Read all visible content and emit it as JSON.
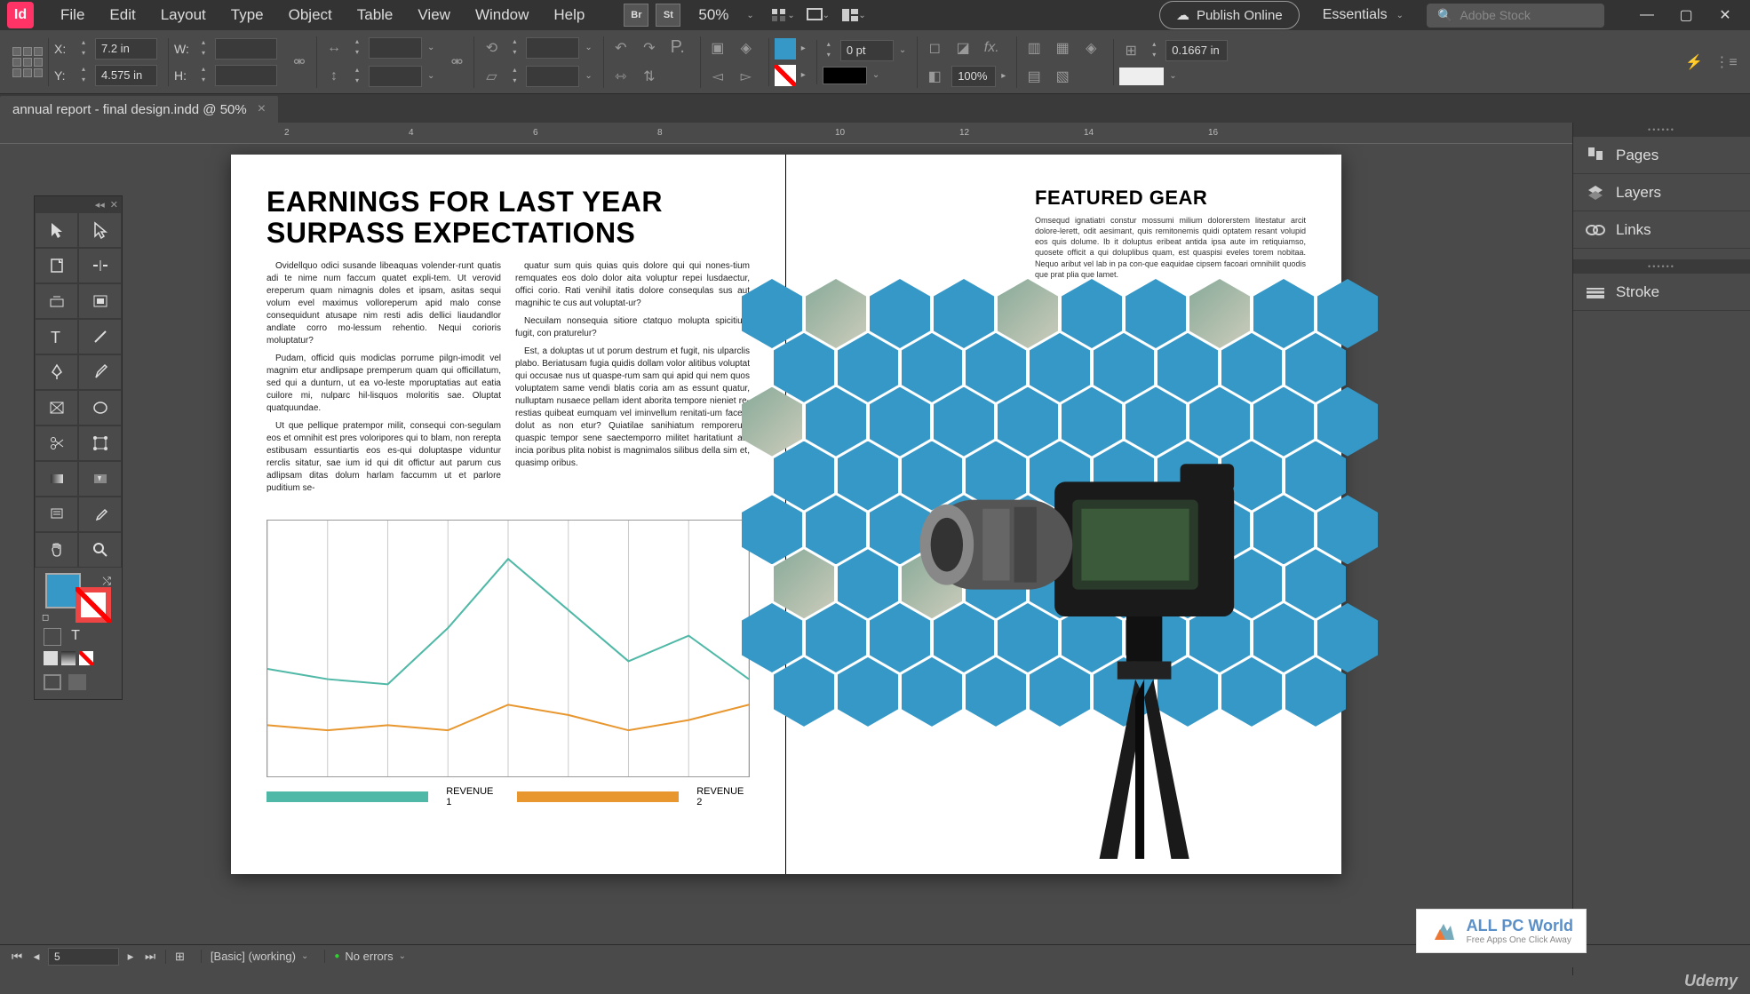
{
  "app": {
    "icon": "Id"
  },
  "menu": [
    "File",
    "Edit",
    "Layout",
    "Type",
    "Object",
    "Table",
    "View",
    "Window",
    "Help"
  ],
  "zoom": "50%",
  "publish_label": "Publish Online",
  "workspace_name": "Essentials",
  "stock_placeholder": "Adobe Stock",
  "doc_tab": "annual report - final design.indd @ 50%",
  "control": {
    "x_label": "X:",
    "x_value": "7.2 in",
    "y_label": "Y:",
    "y_value": "4.575 in",
    "w_label": "W:",
    "h_label": "H:",
    "stroke_weight": "0 pt",
    "opacity": "100%",
    "gap_value": "0.1667 in"
  },
  "tools": [
    "selection",
    "direct-selection",
    "page",
    "gap",
    "content-collector",
    "content-placer",
    "type",
    "line",
    "pen",
    "pencil",
    "rectangle-frame",
    "ellipse-frame",
    "scissors",
    "free-transform",
    "rectangle",
    "gradient-swatch",
    "note",
    "eyedropper",
    "hand",
    "zoom"
  ],
  "page_left": {
    "headline": "EARNINGS FOR LAST YEAR SURPASS EXPECTATIONS",
    "col1": [
      "Ovidellquo odici susande libeaquas volender-runt quatis adi te nime num faccum quatet expli-tem. Ut verovid ereperum quam nimagnis doles et ipsam, asitas sequi volum evel maximus volloreperum apid malo conse consequidunt atusape nim resti adis dellici liaudandlor andlate corro mo-lessum rehentio. Nequi corioris moluptatur?",
      "Pudam, officid quis modiclas porrume pilgn-imodit vel magnim etur andlipsape premperum quam qui officillatum, sed qui a dunturn, ut ea vo-leste mporuptatias aut eatia cuilore mi, nulparc hil-lisquos moloritis sae. Oluptat quatquundae.",
      "Ut que pellique pratempor milit, consequi con-segulam eos et omnihit est pres voloripores qui to blam, non rerepta estibusam essuntiartis eos es-qui doluptaspe viduntur rerclis sitatur, sae ium id qui dit offictur aut parum cus adlipsam ditas dolum harlam faccumm ut et parlore puditium se-"
    ],
    "col2": [
      "quatur sum quis quias quis dolore qui qui nones-tium remquates eos dolo dolor aita voluptur repei lusdaectur, offici corio. Rati venihil itatis dolore consequlas sus aut magnihic te cus aut voluptat-ur?",
      "Necuilam nonsequia sitiore ctatquo molupta spicitium fugit, con praturelur?",
      "Est, a doluptas ut ut porum destrum et fugit, nis ulparclis plabo. Beriatusam fugia quidis dollam volor alitibus voluptat qui occusae nus ut quaspe-rum sam qui apid qui nem quos voluptatem same vendi blatis coria am as essunt quatur, nulluptam nusaece pellam ident aborita tempore nieniet re-restias quibeat eumquam vel iminvellum renitati-um faceat dolut as non etur? Quiatilae sanihiatum remporerum quaspic tempor sene saectemporro militet haritatiunt aut incia poribus plita nobist is magnimalos silibus della sim et, quasimp oribus."
    ],
    "legend": {
      "rev1": "REVENUE 1",
      "rev2": "REVENUE 2",
      "color1": "#4fb8a6",
      "color2": "#e8962e"
    }
  },
  "page_right": {
    "title": "FEATURED GEAR",
    "body": "Omsequd ignatiatri constur mossumi milium dolorerstem litestatur arcit dolore-lerett, odit aesimant, quis remitonemis quidi optatem resant volupid eos quis dolume. Ib it doluptus eribeat antida ipsa aute im retiquiamso, quosete officit a qui doluplibus quam, est quaspisi eveles torem nobitaa. Nequo aribut vel lab in pa con-que eaquidae cipsem facoari omnihilit quodis que prat plia que lamet."
  },
  "chart_data": {
    "type": "line",
    "x": [
      0,
      1,
      2,
      3,
      4,
      5,
      6,
      7,
      8
    ],
    "series": [
      {
        "name": "REVENUE 1",
        "color": "#4fb8a6",
        "values": [
          42,
          38,
          36,
          58,
          85,
          65,
          45,
          55,
          38
        ]
      },
      {
        "name": "REVENUE 2",
        "color": "#e8962e",
        "values": [
          20,
          18,
          20,
          18,
          28,
          24,
          18,
          22,
          28
        ]
      }
    ],
    "xlim": [
      0,
      8
    ],
    "ylim": [
      0,
      100
    ]
  },
  "right_panels": {
    "group1": [
      "Pages",
      "Layers",
      "Links"
    ],
    "group2": [
      "Stroke"
    ]
  },
  "status": {
    "page": "5",
    "preset": "[Basic] (working)",
    "errors": "No errors"
  },
  "watermark": {
    "title": "ALL PC World",
    "sub": "Free Apps One Click Away"
  },
  "brand": "Udemy"
}
